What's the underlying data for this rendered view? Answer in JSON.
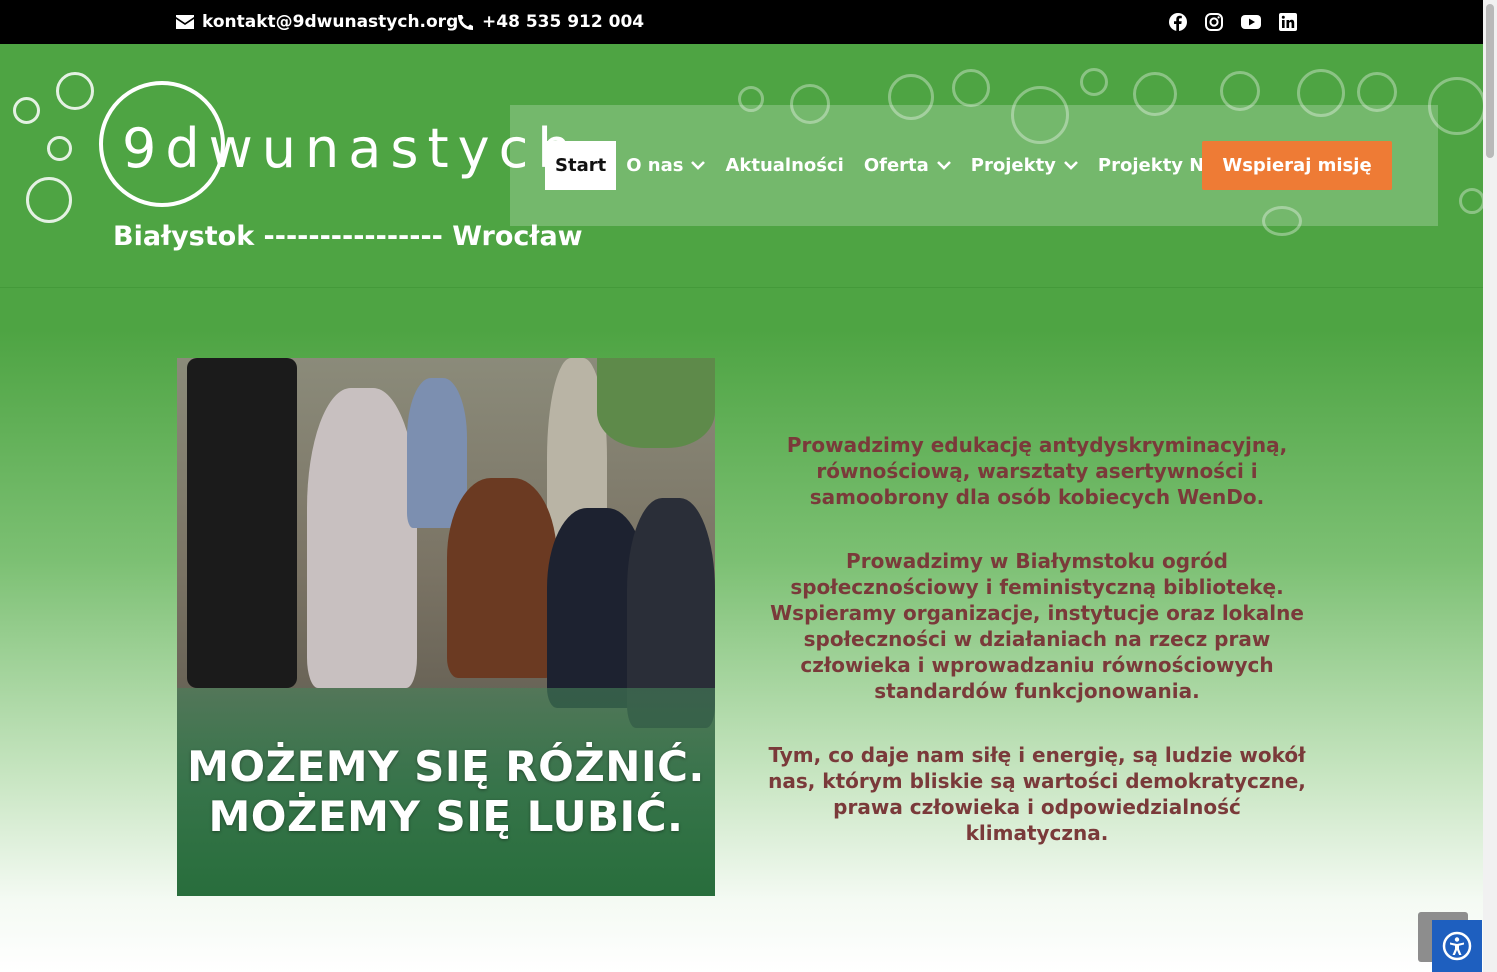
{
  "topbar": {
    "email": "kontakt@9dwunastych.org",
    "phone": "+48 535 912 004",
    "socials": [
      "facebook-icon",
      "instagram-icon",
      "youtube-icon",
      "linkedin-icon"
    ]
  },
  "logo": {
    "text": "9dwunastych",
    "subtitle": "Białystok ---------------- Wrocław"
  },
  "nav": {
    "items": [
      {
        "label": "Start",
        "active": true,
        "dropdown": false
      },
      {
        "label": "O nas",
        "active": false,
        "dropdown": true
      },
      {
        "label": "Aktualności",
        "active": false,
        "dropdown": false
      },
      {
        "label": "Oferta",
        "active": false,
        "dropdown": true
      },
      {
        "label": "Projekty",
        "active": false,
        "dropdown": true
      },
      {
        "label": "Projekty NIW",
        "active": false,
        "dropdown": true
      }
    ],
    "cta": "Wspieraj misję"
  },
  "hero": {
    "slogan_line1": "MOŻEMY SIĘ RÓŻNIĆ.",
    "slogan_line2": "MOŻEMY SIĘ LUBIĆ.",
    "paragraphs": [
      "Prowadzimy edukację antydyskryminacyjną, równościową, warsztaty asertywności i samoobrony dla osób kobiecych WenDo.",
      "Prowadzimy w Białymstoku ogród społecznościowy i feministyczną bibliotekę. Wspieramy organizacje, instytucje oraz lokalne społeczności w działaniach na rzecz praw człowieka i wprowadzaniu równościowych standardów funkcjonowania.",
      "Tym, co daje nam siłę i energię, są ludzie wokół nas, którym bliskie są wartości demokratyczne, prawa człowieka i odpowiedzialność klimatyczna."
    ]
  },
  "colors": {
    "header_green": "#4ea443",
    "cta_orange": "#ee7b35",
    "text_maroon": "#7a3a3a",
    "a11y_blue": "#1e5fbf"
  }
}
